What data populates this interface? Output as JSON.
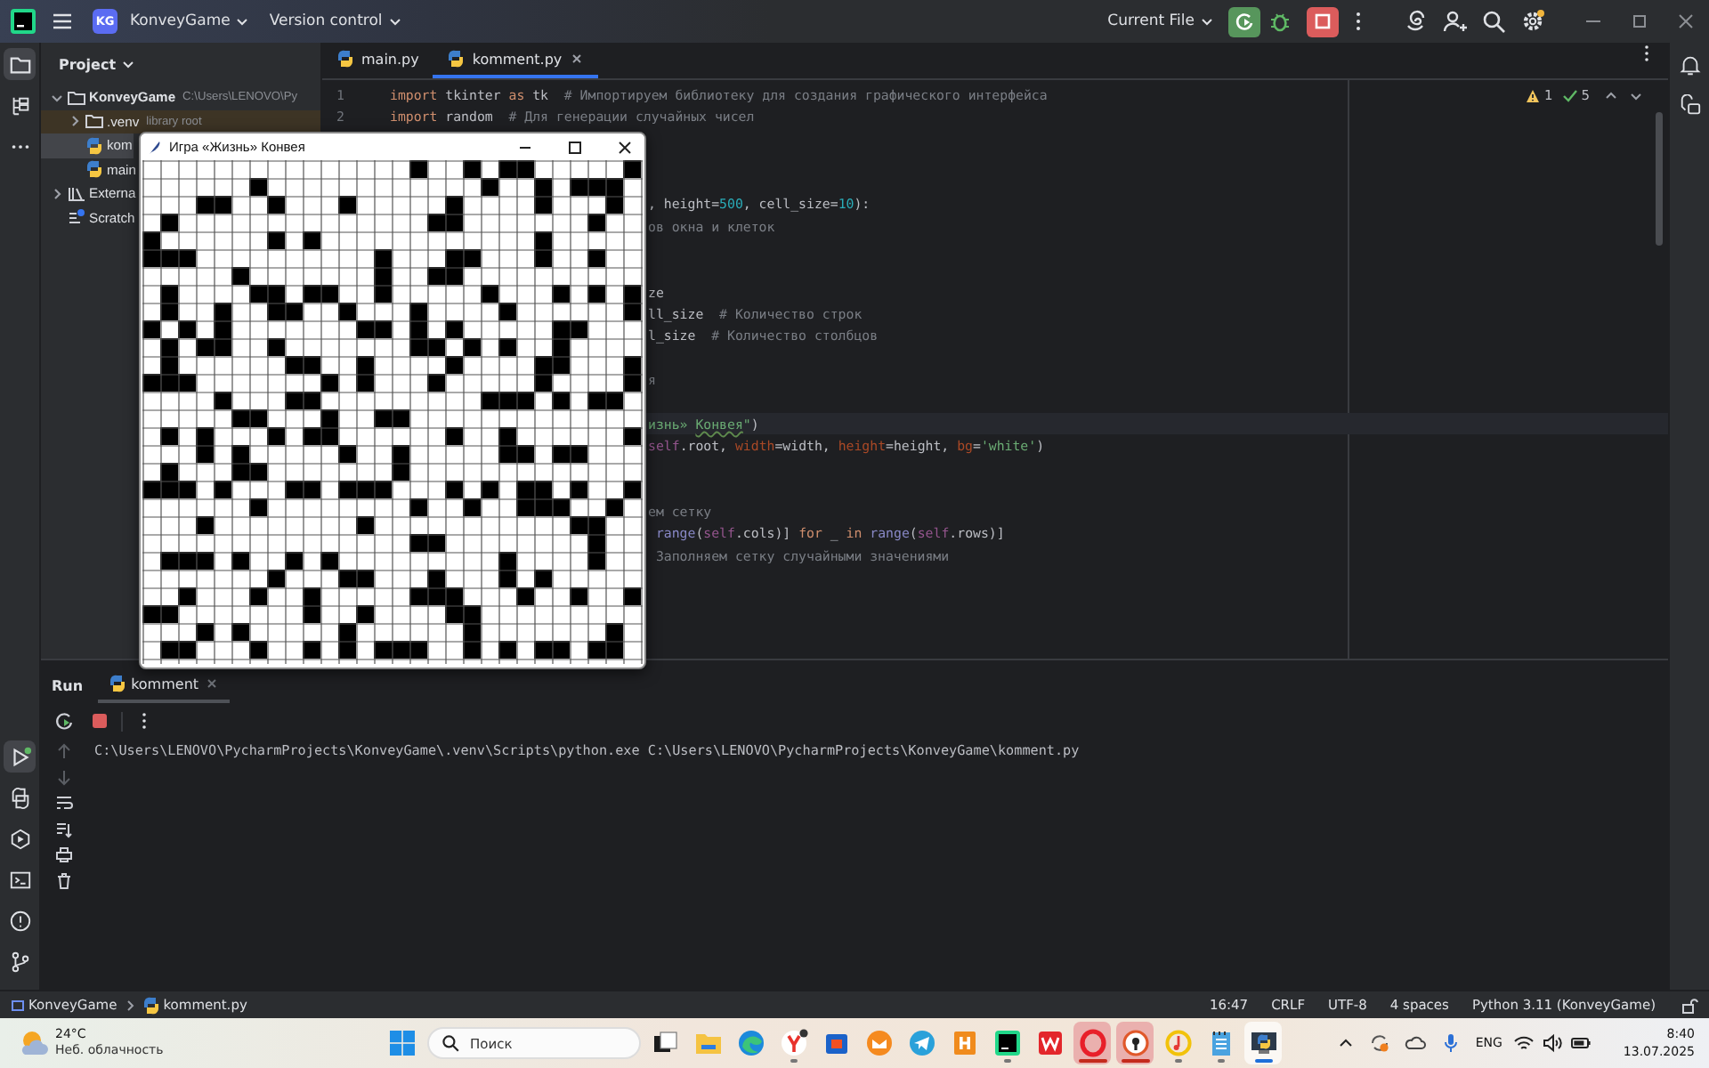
{
  "title_bar": {
    "project_badge": "KG",
    "project": "KonveyGame",
    "vcs": "Version control",
    "run_config": "Current File"
  },
  "left_toolbar": {
    "top": [
      {
        "kind": "folder",
        "selected": true
      },
      {
        "kind": "structure",
        "selected": false
      },
      {
        "kind": "more",
        "selected": false
      }
    ],
    "bottom": [
      {
        "kind": "run",
        "selected": true
      },
      {
        "kind": "python",
        "selected": false
      },
      {
        "kind": "services",
        "selected": false
      },
      {
        "kind": "terminal",
        "selected": false
      },
      {
        "kind": "problems",
        "selected": false
      },
      {
        "kind": "git",
        "selected": false
      }
    ]
  },
  "project_panel": {
    "title": "Project",
    "tree": [
      {
        "name": "KonveyGame",
        "hint": "C:\\Users\\LENOVO\\Py",
        "kind": "folder",
        "expanded": true,
        "selected": false,
        "children": [
          {
            "name": ".venv",
            "hint": "library root",
            "kind": "folder",
            "expanded": false,
            "selected": false,
            "excluded": true
          },
          {
            "name": "kom",
            "kind": "python",
            "selected": true,
            "excluded": false
          },
          {
            "name": "main",
            "kind": "python",
            "selected": false,
            "excluded": false
          }
        ]
      },
      {
        "name": "Externa",
        "kind": "library",
        "expanded": false,
        "selected": false
      },
      {
        "name": "Scratch",
        "kind": "scratch",
        "selected": false
      }
    ]
  },
  "editor": {
    "tabs": [
      {
        "name": "main.py",
        "selected": false
      },
      {
        "name": "komment.py",
        "selected": true
      }
    ],
    "inspections": {
      "warnings": "1",
      "ok": "5"
    },
    "lines": [
      {
        "number": "1",
        "tokens": [
          {
            "t": "import",
            "kind": "kw"
          },
          {
            "t": " tkinter ",
            "kind": "id"
          },
          {
            "t": "as",
            "kind": "kw"
          },
          {
            "t": " tk  ",
            "kind": "id"
          },
          {
            "t": "# Импортируем библиотеку для создания графического интерфейса",
            "kind": "comment"
          }
        ]
      },
      {
        "number": "2",
        "tokens": [
          {
            "t": "import",
            "kind": "kw"
          },
          {
            "t": " random  ",
            "kind": "id"
          },
          {
            "t": "# Для генерации случайных чисел",
            "kind": "comment"
          }
        ]
      },
      {
        "blank": true
      },
      {
        "blank": true
      },
      {
        "blank": true
      },
      {
        "behind_window": true,
        "tokens": [
          {
            "t": ", height=",
            "kind": "id"
          },
          {
            "t": "500",
            "kind": "num"
          },
          {
            "t": ", cell_size=",
            "kind": "id"
          },
          {
            "t": "10",
            "kind": "num"
          },
          {
            "t": "):",
            "kind": "id"
          }
        ]
      },
      {
        "behind_window": true,
        "tokens": [
          {
            "t": "ов окна и клеток",
            "kind": "comment"
          }
        ]
      },
      {
        "blank": true
      },
      {
        "blank": true
      },
      {
        "behind_window": true,
        "tokens": [
          {
            "t": "ze",
            "kind": "id"
          }
        ]
      },
      {
        "behind_window": true,
        "tokens": [
          {
            "t": "ll_size",
            "kind": "id"
          },
          {
            "t": "  # Количество строк",
            "kind": "comment"
          }
        ]
      },
      {
        "behind_window": true,
        "tokens": [
          {
            "t": "l_size",
            "kind": "id"
          },
          {
            "t": "  # Количество столбцов",
            "kind": "comment"
          }
        ]
      },
      {
        "blank": true
      },
      {
        "behind_window": true,
        "tokens": [
          {
            "t": "я",
            "kind": "comment"
          }
        ]
      },
      {
        "blank": true
      },
      {
        "behind_window": true,
        "current": true,
        "tokens": [
          {
            "t": "изнь» ",
            "kind": "str"
          },
          {
            "t": "Конвея",
            "kind": "str",
            "typo": true
          },
          {
            "t": "\"",
            "kind": "str"
          },
          {
            "t": ")",
            "kind": "id"
          }
        ]
      },
      {
        "behind_window": true,
        "tokens": [
          {
            "t": "self",
            "kind": "self"
          },
          {
            "t": ".root, ",
            "kind": "id"
          },
          {
            "t": "width",
            "kind": "param"
          },
          {
            "t": "=width, ",
            "kind": "id"
          },
          {
            "t": "height",
            "kind": "param"
          },
          {
            "t": "=height, ",
            "kind": "id"
          },
          {
            "t": "bg",
            "kind": "param"
          },
          {
            "t": "=",
            "kind": "id"
          },
          {
            "t": "'white'",
            "kind": "str"
          },
          {
            "t": ")",
            "kind": "id"
          }
        ]
      },
      {
        "blank": true
      },
      {
        "blank": true
      },
      {
        "behind_window": true,
        "tokens": [
          {
            "t": "ем сетку",
            "kind": "comment"
          }
        ]
      },
      {
        "behind_window": true,
        "tokens": [
          {
            "t": " range",
            "kind": "builtin"
          },
          {
            "t": "(",
            "kind": "id"
          },
          {
            "t": "self",
            "kind": "self"
          },
          {
            "t": ".cols)] ",
            "kind": "id"
          },
          {
            "t": "for",
            "kind": "kw"
          },
          {
            "t": " _ ",
            "kind": "id"
          },
          {
            "t": "in",
            "kind": "kw"
          },
          {
            "t": " range",
            "kind": "builtin"
          },
          {
            "t": "(",
            "kind": "id"
          },
          {
            "t": "self",
            "kind": "self"
          },
          {
            "t": ".rows)]",
            "kind": "id"
          }
        ]
      },
      {
        "behind_window": true,
        "tokens": [
          {
            "t": " Заполняем сетку случайными значениями",
            "kind": "comment"
          }
        ]
      }
    ]
  },
  "tk_window": {
    "title": "Игра «Жизнь» Конвея"
  },
  "run_panel": {
    "tabs": [
      {
        "label": "Run",
        "kind": "title"
      },
      {
        "label": "komment",
        "kind": "config",
        "selected": true
      }
    ],
    "output": [
      "C:\\Users\\LENOVO\\PycharmProjects\\KonveyGame\\.venv\\Scripts\\python.exe C:\\Users\\LENOVO\\PycharmProjects\\KonveyGame\\komment.py"
    ]
  },
  "status_bar": {
    "breadcrumbs": [
      "KonveyGame",
      "komment.py"
    ],
    "position": "16:47",
    "line_separator": "CRLF",
    "encoding": "UTF-8",
    "indent": "4 spaces",
    "interpreter": "Python 3.11 (KonveyGame)"
  },
  "taskbar": {
    "weather": {
      "temperature": "24°C",
      "condition": "Неб. облачность"
    },
    "search": {
      "placeholder": "Поиск"
    },
    "apps": [
      {
        "kind": "taskview",
        "running": false,
        "attention": false,
        "selected": false
      },
      {
        "kind": "explorer",
        "running": false,
        "attention": false,
        "selected": false
      },
      {
        "kind": "edge",
        "running": false,
        "attention": false,
        "selected": false
      },
      {
        "kind": "yandex",
        "running": true,
        "attention": false,
        "selected": false
      },
      {
        "kind": "store",
        "running": false,
        "attention": false,
        "selected": false
      },
      {
        "kind": "mail",
        "running": false,
        "attention": false,
        "selected": false
      },
      {
        "kind": "telegram",
        "running": false,
        "attention": false,
        "selected": false
      },
      {
        "kind": "hkey",
        "running": false,
        "attention": false,
        "selected": false
      },
      {
        "kind": "pycharm",
        "running": true,
        "attention": false,
        "selected": false
      },
      {
        "kind": "wps",
        "running": false,
        "attention": false,
        "selected": false
      },
      {
        "kind": "opera",
        "running": true,
        "attention": true,
        "selected": false
      },
      {
        "kind": "vpn",
        "running": true,
        "attention": true,
        "selected": false
      },
      {
        "kind": "music",
        "running": true,
        "attention": false,
        "selected": false
      },
      {
        "kind": "notepad",
        "running": true,
        "attention": false,
        "selected": false
      },
      {
        "kind": "python",
        "running": true,
        "attention": false,
        "selected": true
      }
    ],
    "language": "ENG",
    "time": "8:40",
    "date": "13.07.2025"
  }
}
